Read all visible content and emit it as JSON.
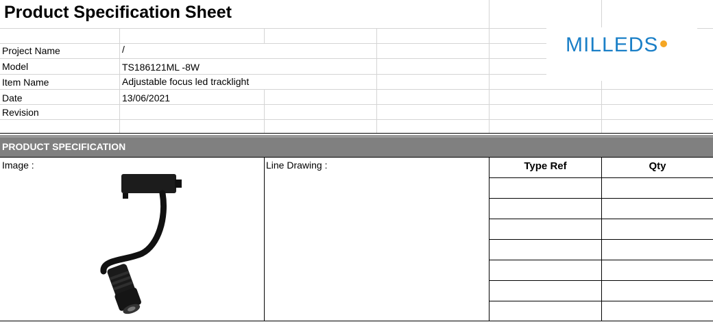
{
  "title": "Product Specification Sheet",
  "info": [
    {
      "label": "Project Name",
      "value": "/"
    },
    {
      "label": "Model",
      "value": "TS186121ML -8W"
    },
    {
      "label": "Item Name",
      "value": "Adjustable focus led tracklight"
    },
    {
      "label": "Date",
      "value": "13/06/2021"
    },
    {
      "label": "Revision",
      "value": ""
    }
  ],
  "logo": {
    "text": "MILLEDS",
    "color": "#1a7fc7",
    "accent": "#f5a623"
  },
  "section": {
    "title": "PRODUCT SPECIFICATION"
  },
  "image_label": "Image :",
  "drawing_label": "Line Drawing :",
  "table": {
    "headers": [
      "Type Ref",
      "Qty"
    ]
  },
  "colors": {
    "band": "#808080",
    "grid": "#d4d4d4"
  }
}
